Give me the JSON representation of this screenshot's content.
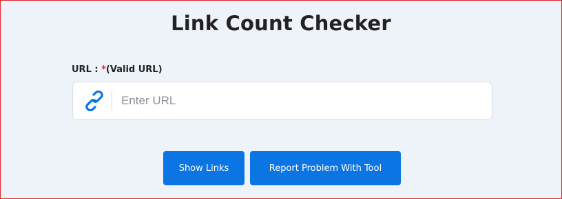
{
  "title": "Link Count Checker",
  "url_field": {
    "label": "URL :",
    "required_marker": "*",
    "hint": "(Valid URL)",
    "placeholder": "Enter URL",
    "value": "",
    "icon": "link-icon"
  },
  "buttons": {
    "show_links": "Show Links",
    "report_problem": "Report Problem With Tool"
  },
  "colors": {
    "accent": "#0a75e3",
    "required": "#e0242c",
    "background": "#eef2f9",
    "frame_border": "#e0242c"
  }
}
